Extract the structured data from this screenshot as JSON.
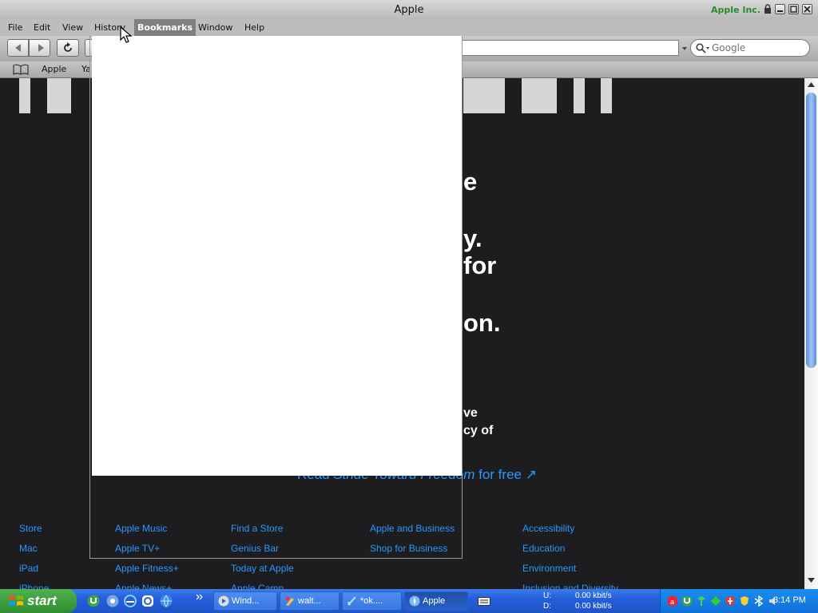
{
  "window": {
    "title": "Apple",
    "site_identity": "Apple Inc."
  },
  "menubar": {
    "items": [
      "File",
      "Edit",
      "View",
      "History",
      "Bookmarks",
      "Window",
      "Help"
    ],
    "active": "Bookmarks"
  },
  "toolbar": {
    "search_placeholder": "Google"
  },
  "bookmarks_bar": {
    "items": [
      "Apple",
      "Ya"
    ]
  },
  "page": {
    "hero_fragments": [
      "e",
      "y.",
      "for",
      "on.",
      "ve",
      "cy of"
    ],
    "read_link": {
      "prefix": "Read",
      "title": "Stride Toward Freedom",
      "suffix": "for free ↗"
    },
    "footer": {
      "col1": [
        "Store",
        "Mac",
        "iPad",
        "iPhone"
      ],
      "col2": [
        "Apple Music",
        "Apple TV+",
        "Apple Fitness+",
        "Apple News+"
      ],
      "col3": [
        "Find a Store",
        "Genius Bar",
        "Today at Apple",
        "Apple Camp"
      ],
      "col4": [
        "Apple and Business",
        "Shop for Business"
      ],
      "col5": [
        "Accessibility",
        "Education",
        "Environment",
        "Inclusion and Diversity"
      ]
    }
  },
  "taskbar": {
    "start_label": "start",
    "tasks": [
      {
        "label": "Wind...",
        "icon": "media-player-icon"
      },
      {
        "label": "walt...",
        "icon": "paint-icon"
      },
      {
        "label": "*ok....",
        "icon": "editor-icon"
      },
      {
        "label": "Apple",
        "icon": "safari-icon",
        "active": true
      }
    ],
    "upload": "0.00 kbit/s",
    "download": "0.00 kbit/s",
    "upload_label": "U:",
    "download_label": "D:",
    "clock": "3:14 PM"
  },
  "colors": {
    "accent_link": "#2997ff",
    "page_bg": "#1d1d1f",
    "taskbar_blue": "#245edb",
    "start_green": "#2f8d2f"
  }
}
